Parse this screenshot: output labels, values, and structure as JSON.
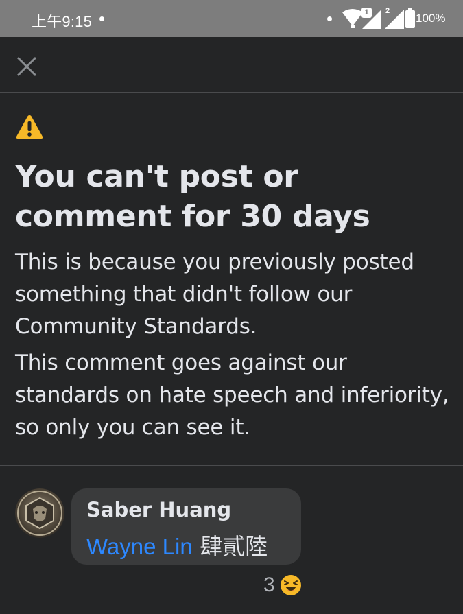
{
  "status_bar": {
    "time": "上午9:15",
    "sim1_badge": "1",
    "sim2_badge": "2",
    "battery": "100%"
  },
  "icons": {
    "close": "close-icon",
    "warning": "warning-icon",
    "wifi": "wifi-icon",
    "signal": "signal-icon",
    "battery": "battery-icon",
    "reaction": "haha-emoji-icon"
  },
  "colors": {
    "background": "#242526",
    "status_bar": "#7d7d7d",
    "bubble": "#3a3b3c",
    "mention": "#2d88ff",
    "warning": "#f7b928",
    "text": "#e4e6eb"
  },
  "notice": {
    "title": "You can't post or comment for 30 days",
    "reason": "This is because you previously posted something that didn't follow our Community Standards.",
    "detail": "This comment goes against our standards on hate speech and inferiority, so only you can see it."
  },
  "comment": {
    "author": "Saber Huang",
    "mention": "Wayne Lin",
    "text": "肆貳陸",
    "reaction_count": "3"
  }
}
